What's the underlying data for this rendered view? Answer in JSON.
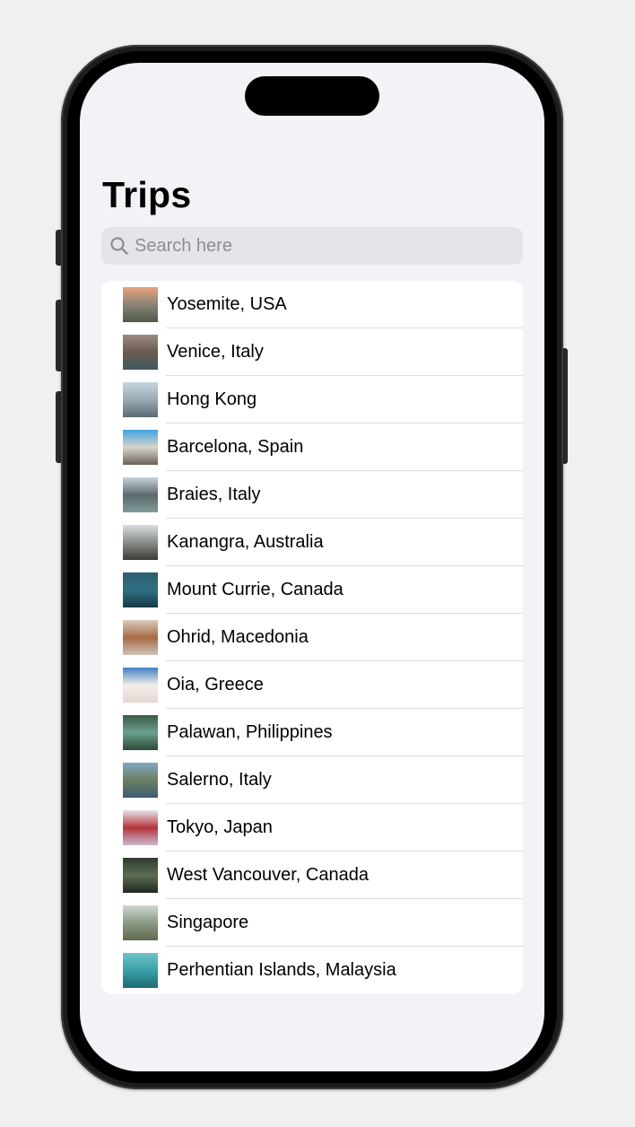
{
  "header": {
    "title": "Trips"
  },
  "search": {
    "placeholder": "Search here",
    "value": ""
  },
  "trips": [
    {
      "label": "Yosemite, USA",
      "thumb": [
        "#e8a27c",
        "#8a8376",
        "#4e5a4a"
      ]
    },
    {
      "label": "Venice, Italy",
      "thumb": [
        "#9a8a80",
        "#6b5a4f",
        "#3f5a60"
      ]
    },
    {
      "label": "Hong Kong",
      "thumb": [
        "#c7d6e0",
        "#9aaab5",
        "#5b6b74"
      ]
    },
    {
      "label": "Barcelona, Spain",
      "thumb": [
        "#3fa4e0",
        "#d8d4cc",
        "#6a625a"
      ]
    },
    {
      "label": "Braies, Italy",
      "thumb": [
        "#c9d3dc",
        "#5d6a6e",
        "#7f9a96"
      ]
    },
    {
      "label": "Kanangra, Australia",
      "thumb": [
        "#d8dde2",
        "#8b8f8a",
        "#3c3a34"
      ]
    },
    {
      "label": "Mount Currie, Canada",
      "thumb": [
        "#2d5d6e",
        "#2e7083",
        "#173a45"
      ]
    },
    {
      "label": "Ohrid, Macedonia",
      "thumb": [
        "#d9ccbe",
        "#a86a45",
        "#cfc2b4"
      ]
    },
    {
      "label": "Oia, Greece",
      "thumb": [
        "#3f7fc4",
        "#f2eee9",
        "#e6d6d0"
      ]
    },
    {
      "label": "Palawan, Philippines",
      "thumb": [
        "#3b5a45",
        "#6aa08e",
        "#2c4a38"
      ]
    },
    {
      "label": "Salerno, Italy",
      "thumb": [
        "#7fa9c4",
        "#6b7f60",
        "#3f5c74"
      ]
    },
    {
      "label": "Tokyo, Japan",
      "thumb": [
        "#e6e4ea",
        "#b4343a",
        "#c8b8d0"
      ]
    },
    {
      "label": "West Vancouver, Canada",
      "thumb": [
        "#2f3b2e",
        "#5c6c52",
        "#1f2a20"
      ]
    },
    {
      "label": "Singapore",
      "thumb": [
        "#cfd8d4",
        "#8a9a84",
        "#5f6a4e"
      ]
    },
    {
      "label": "Perhentian Islands, Malaysia",
      "thumb": [
        "#6fc4c8",
        "#39a0a8",
        "#1f6a72"
      ]
    }
  ]
}
